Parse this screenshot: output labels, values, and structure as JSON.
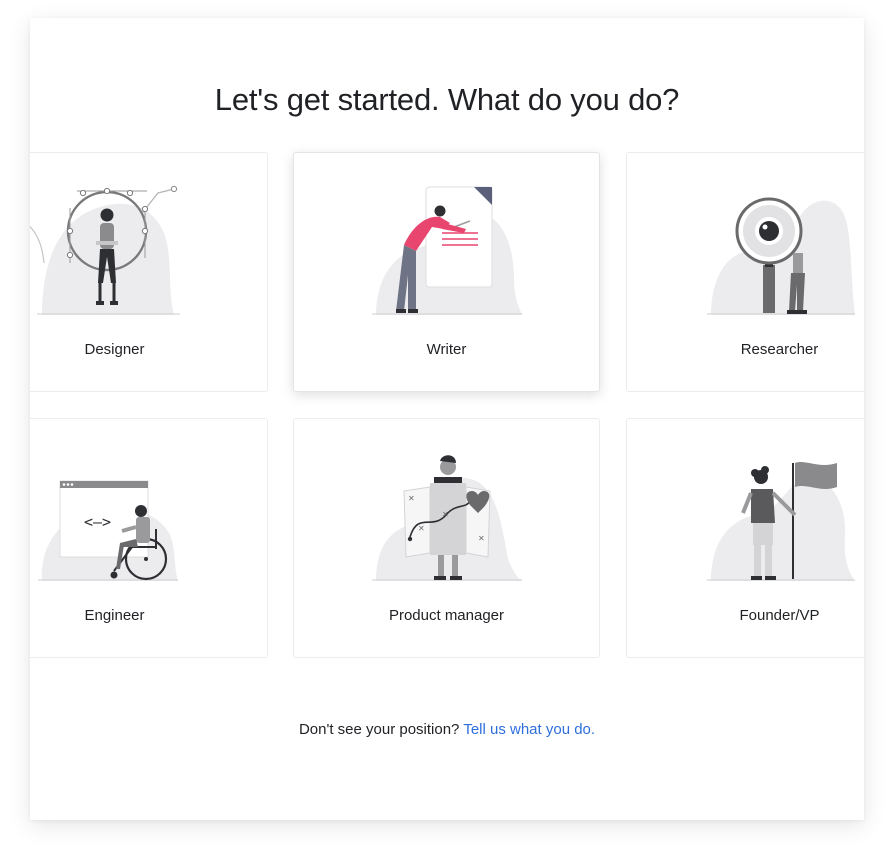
{
  "header": {
    "title": "Let's get started. What do you do?"
  },
  "roles": [
    {
      "label": "Designer",
      "illustration": "designer-illustration"
    },
    {
      "label": "Writer",
      "illustration": "writer-illustration"
    },
    {
      "label": "Researcher",
      "illustration": "researcher-illustration"
    },
    {
      "label": "Engineer",
      "illustration": "engineer-illustration"
    },
    {
      "label": "Product manager",
      "illustration": "product-manager-illustration"
    },
    {
      "label": "Founder/VP",
      "illustration": "founder-illustration"
    }
  ],
  "footer": {
    "prompt": "Don't see your position?",
    "link": "Tell us what you do."
  },
  "colors": {
    "accent_pink": "#e8456f",
    "link_blue": "#2f6fdc",
    "blob_gray": "#ececee",
    "figure_dark": "#2e2f33"
  }
}
